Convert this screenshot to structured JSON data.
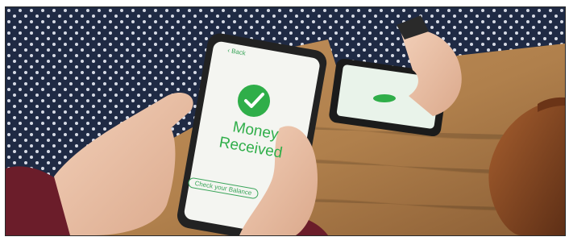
{
  "photo": {
    "description_colors": {
      "table": "#b8864e",
      "shirt": "#1f2a44",
      "sleeve": "#6b1d2a",
      "bag": "#8a4a25",
      "screen_green": "#2fae49"
    }
  },
  "phone_main": {
    "back_label": "‹ Back",
    "title_line1": "Money",
    "title_line2": "Received",
    "button_label": "Check your Balance"
  }
}
